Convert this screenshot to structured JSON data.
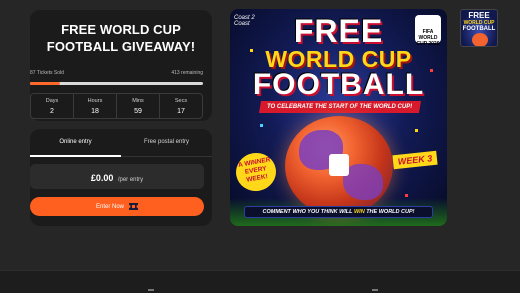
{
  "giveaway": {
    "title": "FREE WORLD CUP FOOTBALL GIVEAWAY!",
    "tickets_sold": "87 Tickets Sold",
    "tickets_remaining": "413 remaining",
    "progress_fraction": 0.174
  },
  "countdown": [
    {
      "label": "Days",
      "value": "2"
    },
    {
      "label": "Hours",
      "value": "18"
    },
    {
      "label": "Mins",
      "value": "59"
    },
    {
      "label": "Secs",
      "value": "17"
    }
  ],
  "entry": {
    "tabs": [
      {
        "label": "Online entry",
        "active": true
      },
      {
        "label": "Free postal entry",
        "active": false
      }
    ],
    "price": "£0.00",
    "price_suffix": "/per entry",
    "enter_label": "Enter Now",
    "enter_icon": "ticket-icon"
  },
  "poster": {
    "badge_text": "Coast 2 Coast",
    "line1": "FREE",
    "line2": "WORLD CUP",
    "line3": "FOOTBALL",
    "banner": "TO CELEBRATE THE START OF THE WORLD CUP!",
    "fifa_text": "FIFA WORLD CUP 2026",
    "winner_text": "A WINNER EVERY WEEK!",
    "week_text": "WEEK 3",
    "bottom_pre": "COMMENT WHO YOU THINK WILL ",
    "bottom_win": "WIN",
    "bottom_post": " THE WORLD CUP!"
  },
  "thumbnail": {
    "free": "FREE",
    "wc": "WORLD CUP",
    "fb": "FOOTBALL"
  },
  "colors": {
    "accent": "#ff5f1f",
    "card_bg": "#1b1b1b",
    "page_bg": "#262626"
  }
}
